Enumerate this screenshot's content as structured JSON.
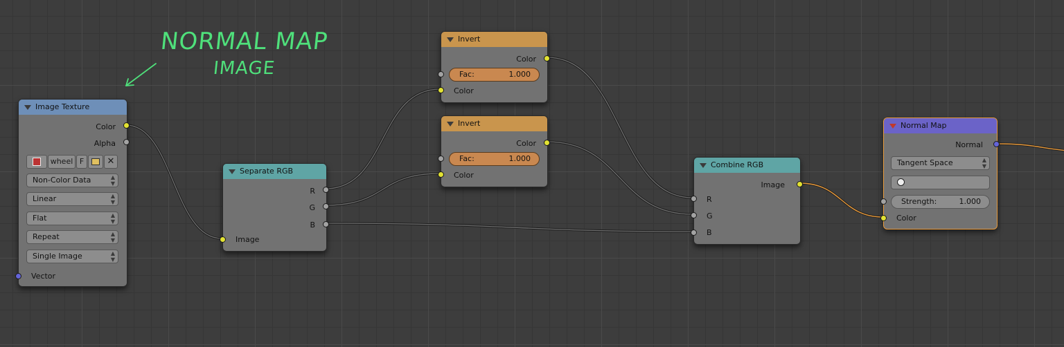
{
  "annotation": {
    "line1": "NORMAL MAP",
    "line2": "IMAGE"
  },
  "colors": {
    "header_image": "#6e8fb8",
    "header_converter": "#5fa5a5",
    "header_color": "#c9954d",
    "header_vector": "#6b63c8",
    "socket_color": "#e2e233",
    "socket_float": "#a3a3a3",
    "socket_vector": "#6464d8",
    "link_selected": "#e89a3c"
  },
  "nodes": {
    "image_texture": {
      "title": "Image Texture",
      "outputs": [
        "Color",
        "Alpha"
      ],
      "image_name": "wheel",
      "fake_user": "F",
      "color_space": "Non-Color Data",
      "interpolation": "Linear",
      "projection": "Flat",
      "extension": "Repeat",
      "source": "Single Image",
      "input": "Vector"
    },
    "separate_rgb": {
      "title": "Separate RGB",
      "outputs": [
        "R",
        "G",
        "B"
      ],
      "input": "Image"
    },
    "invert1": {
      "title": "Invert",
      "output": "Color",
      "fac_label": "Fac:",
      "fac_value": "1.000",
      "input": "Color"
    },
    "invert2": {
      "title": "Invert",
      "output": "Color",
      "fac_label": "Fac:",
      "fac_value": "1.000",
      "input": "Color"
    },
    "combine_rgb": {
      "title": "Combine RGB",
      "output": "Image",
      "inputs": [
        "R",
        "G",
        "B"
      ]
    },
    "normal_map": {
      "title": "Normal Map",
      "output": "Normal",
      "space": "Tangent Space",
      "strength_label": "Strength:",
      "strength_value": "1.000",
      "input": "Color"
    }
  }
}
